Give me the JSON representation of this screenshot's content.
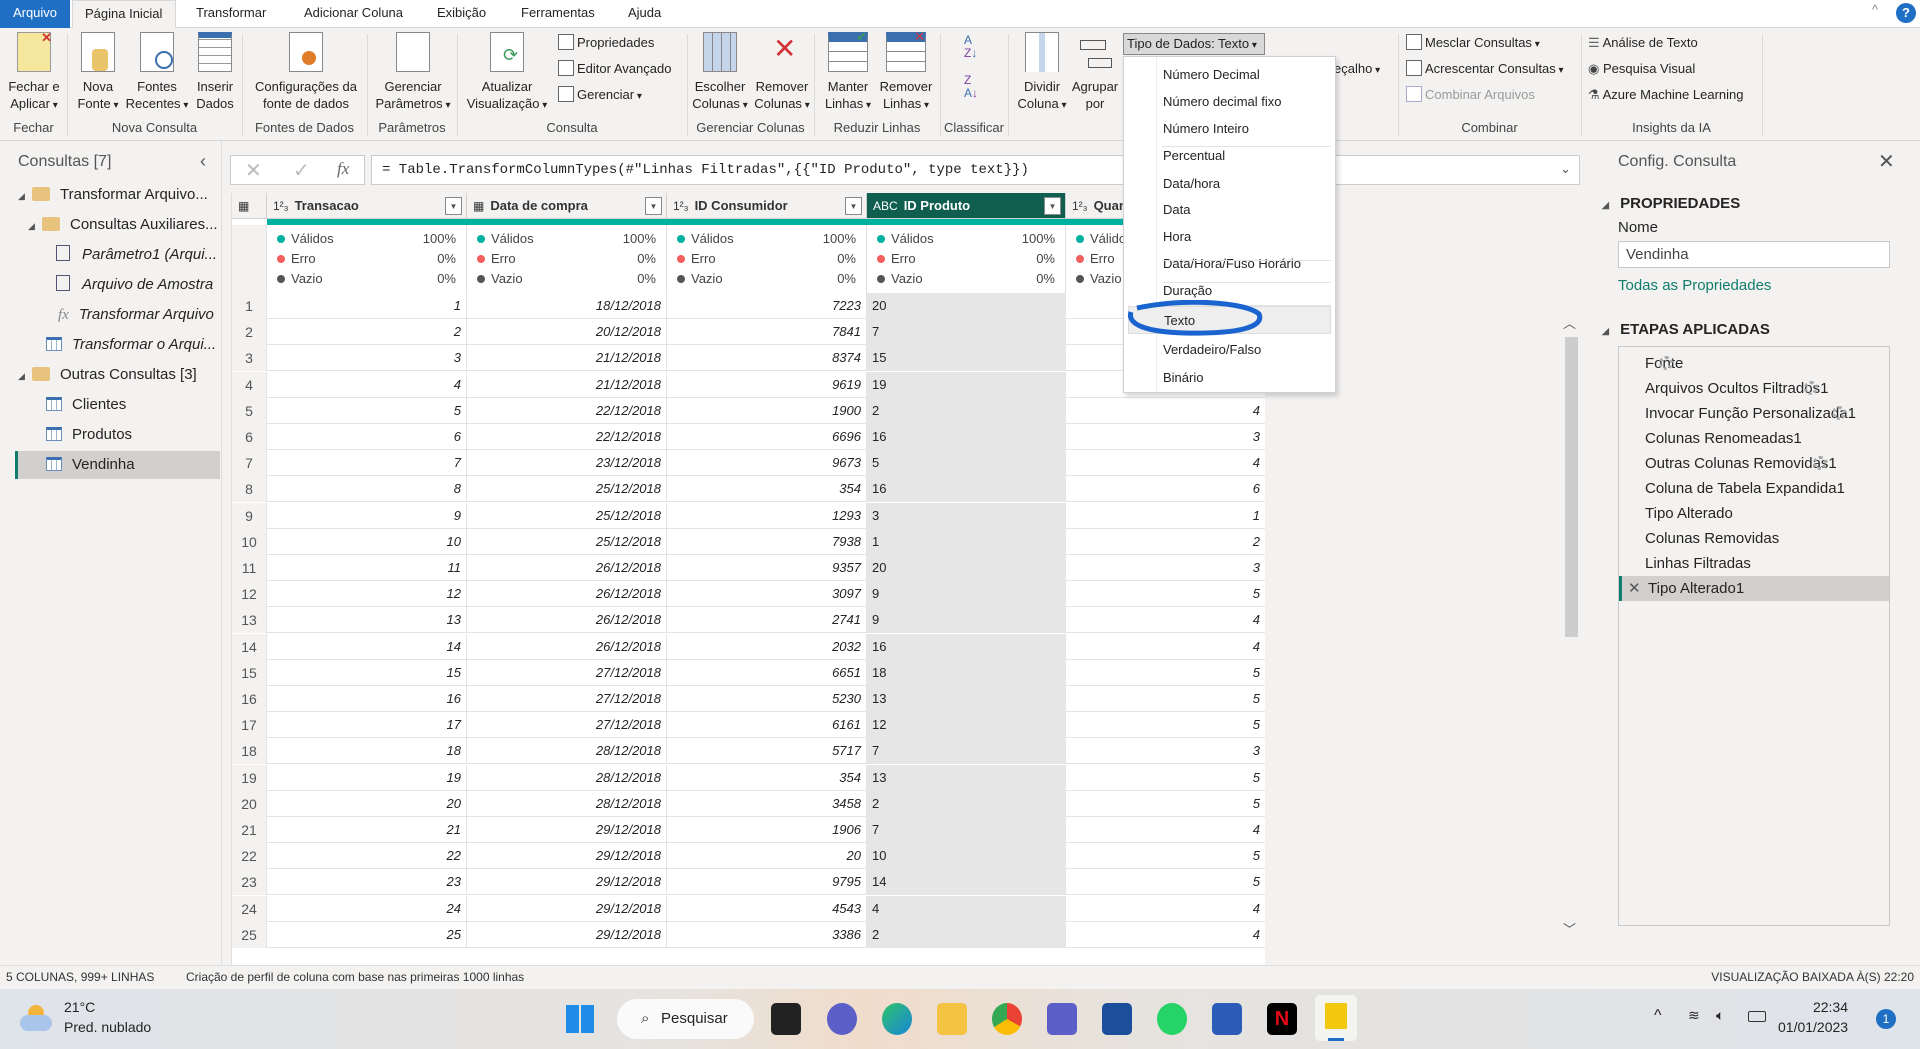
{
  "tabs": [
    "Arquivo",
    "Página Inicial",
    "Transformar",
    "Adicionar Coluna",
    "Exibição",
    "Ferramentas",
    "Ajuda"
  ],
  "ribbon": {
    "buttons": {
      "fechar": "Fechar e",
      "aplicar": "Aplicar",
      "nova": "Nova",
      "fonte": "Fonte",
      "fontes": "Fontes",
      "recentes": "Recentes",
      "inserir": "Inserir",
      "dados": "Dados",
      "config1": "Configurações da",
      "config2": "fonte de dados",
      "gerenciar": "Gerenciar",
      "parametros": "Parâmetros",
      "atualizar": "Atualizar",
      "visualizacao": "Visualização",
      "propriedades": "Propriedades",
      "editor": "Editor Avançado",
      "gerenciar_sm": "Gerenciar",
      "escolher": "Escolher",
      "colunas": "Colunas",
      "remover": "Remover",
      "colunas2": "Colunas",
      "manter": "Manter",
      "linhas": "Linhas",
      "remover2": "Remover",
      "linhas2": "Linhas",
      "dividir": "Dividir",
      "coluna": "Coluna",
      "agrupar": "Agrupar",
      "por": "por",
      "tipo_dados": "Tipo de Dados: Texto",
      "cabecalho": "eçalho",
      "mesclar": "Mesclar Consultas",
      "acrescentar": "Acrescentar Consultas",
      "combinar_arq": "Combinar Arquivos",
      "analise": "Análise de Texto",
      "pesquisa": "Pesquisa Visual",
      "azure": "Azure Machine Learning"
    },
    "groups": [
      "Fechar",
      "Nova Consulta",
      "Fontes de Dados",
      "Parâmetros",
      "Consulta",
      "Gerenciar Colunas",
      "Reduzir Linhas",
      "Classificar",
      "Combinar",
      "Insights da IA"
    ]
  },
  "datatype_menu": {
    "items": [
      "Número Decimal",
      "Número decimal fixo",
      "Número Inteiro",
      "Percentual",
      "Data/hora",
      "Data",
      "Hora",
      "Data/Hora/Fuso Horário",
      "Duração",
      "Texto",
      "Verdadeiro/Falso",
      "Binário"
    ],
    "selected": "Texto"
  },
  "queries": {
    "title": "Consultas [7]",
    "items": [
      "Transformar Arquivo...",
      "Consultas Auxiliares...",
      "Parâmetro1 (Arqui...",
      "Arquivo de Amostra",
      "Transformar Arquivo",
      "Transformar o Arqui...",
      "Outras Consultas [3]",
      "Clientes",
      "Produtos",
      "Vendinha"
    ],
    "selected": "Vendinha"
  },
  "formula": "= Table.TransformColumnTypes(#\"Linhas Filtradas\",{{\"ID Produto\", type text}})",
  "grid": {
    "columns": [
      {
        "type": "1²₃",
        "name": "Transacao"
      },
      {
        "type": "date",
        "name": "Data de compra"
      },
      {
        "type": "1²₃",
        "name": "ID Consumidor"
      },
      {
        "type": "ABC",
        "name": "ID Produto"
      },
      {
        "type": "1²₃",
        "name": "Quantidade"
      }
    ],
    "profile": {
      "labels": [
        "Válidos",
        "Erro",
        "Vazio"
      ],
      "values": [
        "100%",
        "0%",
        "0%"
      ],
      "colors": [
        "#00b1a0",
        "#f25f5c",
        "#555555"
      ]
    },
    "rows": [
      [
        1,
        "18/12/2018",
        7223,
        "20",
        ""
      ],
      [
        2,
        "20/12/2018",
        7841,
        "7",
        ""
      ],
      [
        3,
        "21/12/2018",
        8374,
        "15",
        ""
      ],
      [
        4,
        "21/12/2018",
        9619,
        "19",
        ""
      ],
      [
        5,
        "22/12/2018",
        1900,
        "2",
        4
      ],
      [
        6,
        "22/12/2018",
        6696,
        "16",
        3
      ],
      [
        7,
        "23/12/2018",
        9673,
        "5",
        4
      ],
      [
        8,
        "25/12/2018",
        354,
        "16",
        6
      ],
      [
        9,
        "25/12/2018",
        1293,
        "3",
        1
      ],
      [
        10,
        "25/12/2018",
        7938,
        "1",
        2
      ],
      [
        11,
        "26/12/2018",
        9357,
        "20",
        3
      ],
      [
        12,
        "26/12/2018",
        3097,
        "9",
        5
      ],
      [
        13,
        "26/12/2018",
        2741,
        "9",
        4
      ],
      [
        14,
        "26/12/2018",
        2032,
        "16",
        4
      ],
      [
        15,
        "27/12/2018",
        6651,
        "18",
        5
      ],
      [
        16,
        "27/12/2018",
        5230,
        "13",
        5
      ],
      [
        17,
        "27/12/2018",
        6161,
        "12",
        5
      ],
      [
        18,
        "28/12/2018",
        5717,
        "7",
        3
      ],
      [
        19,
        "28/12/2018",
        354,
        "13",
        5
      ],
      [
        20,
        "28/12/2018",
        3458,
        "2",
        5
      ],
      [
        21,
        "29/12/2018",
        1906,
        "7",
        4
      ],
      [
        22,
        "29/12/2018",
        20,
        "10",
        5
      ],
      [
        23,
        "29/12/2018",
        9795,
        "14",
        5
      ],
      [
        24,
        "29/12/2018",
        4543,
        "4",
        4
      ],
      [
        25,
        "29/12/2018",
        3386,
        "2",
        4
      ]
    ]
  },
  "settings": {
    "title": "Config. Consulta",
    "properties": "PROPRIEDADES",
    "name_label": "Nome",
    "name_value": "Vendinha",
    "all_props": "Todas as Propriedades",
    "steps_title": "ETAPAS APLICADAS",
    "steps": [
      {
        "name": "Fonte",
        "gear": true
      },
      {
        "name": "Arquivos Ocultos Filtrados1",
        "gear": true
      },
      {
        "name": "Invocar Função Personalizada1",
        "gear": true
      },
      {
        "name": "Colunas Renomeadas1",
        "gear": false
      },
      {
        "name": "Outras Colunas Removidas1",
        "gear": true
      },
      {
        "name": "Coluna de Tabela Expandida1",
        "gear": false
      },
      {
        "name": "Tipo Alterado",
        "gear": false
      },
      {
        "name": "Colunas Removidas",
        "gear": false
      },
      {
        "name": "Linhas Filtradas",
        "gear": false
      },
      {
        "name": "Tipo Alterado1",
        "gear": false
      }
    ],
    "selected": "Tipo Alterado1"
  },
  "status": {
    "left": "5 COLUNAS, 999+ LINHAS",
    "profile": "Criação de perfil de coluna com base nas primeiras 1000 linhas",
    "right": "VISUALIZAÇÃO BAIXADA À(S) 22:20"
  },
  "taskbar": {
    "temp": "21°C",
    "weather": "Pred. nublado",
    "search": "Pesquisar",
    "time": "22:34",
    "date": "01/01/2023",
    "badge": "1"
  }
}
